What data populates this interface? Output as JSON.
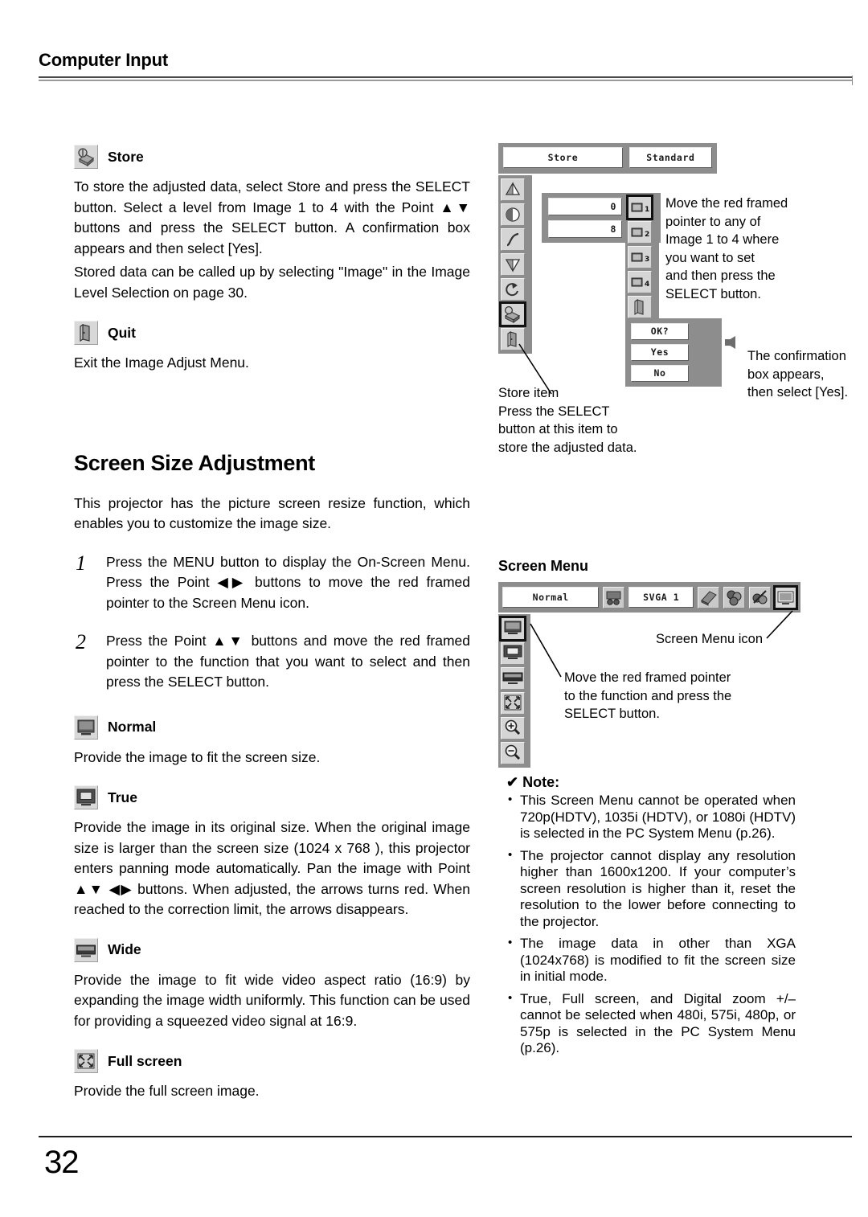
{
  "header": {
    "title": "Computer Input"
  },
  "left": {
    "store": {
      "icon": "store-hand-icon",
      "heading": "Store",
      "paragraph1": "To store the adjusted data, select Store and press the SELECT button.  Select a level from Image 1 to 4 with the Point ▲▼ buttons and press the SELECT button.  A confirmation box appears and then select [Yes].",
      "paragraph2": "Stored data can be called up by selecting \"Image\" in the Image Level Selection on page 30."
    },
    "quit": {
      "icon": "quit-door-icon",
      "heading": "Quit",
      "paragraph": "Exit the Image Adjust Menu."
    },
    "screen_size": {
      "title": "Screen Size Adjustment",
      "intro": "This projector has the picture screen resize function, which enables you to customize the image size.",
      "steps": [
        {
          "num": "1",
          "text": "Press the MENU button to display the On-Screen Menu.  Press the Point ◀▶ buttons to move the red framed pointer to the Screen Menu icon."
        },
        {
          "num": "2",
          "text": "Press the Point ▲▼ buttons and move the red framed pointer to the function that you want to select and then press the SELECT button."
        }
      ],
      "modes": [
        {
          "icon": "normal-screen-icon",
          "heading": "Normal",
          "text": "Provide the image to fit the screen size."
        },
        {
          "icon": "true-screen-icon",
          "heading": "True",
          "text": "Provide the image in its original size. When the original image size is larger than the screen size (1024 x 768 ), this projector enters panning mode automatically. Pan the image with Point ▲▼ ◀▶ buttons.  When adjusted, the arrows turns red.  When reached to the correction limit, the arrows disappears."
        },
        {
          "icon": "wide-screen-icon",
          "heading": "Wide",
          "text": "Provide the image to fit wide video aspect ratio (16:9) by expanding the image width uniformly.  This function can be used for providing a squeezed video signal at 16:9."
        },
        {
          "icon": "full-screen-icon",
          "heading": "Full screen",
          "text": "Provide the full screen image."
        }
      ]
    }
  },
  "image_adjust_osd": {
    "topbar": {
      "store_label": "Store",
      "standard_label": "Standard"
    },
    "menu_icons": [
      "contrast-up-icon",
      "contrast-icon",
      "gamma-curve-icon",
      "contrast-down-icon",
      "reset-icon",
      "store-hand-icon",
      "quit-door-icon"
    ],
    "selected_menu_icon": "store-hand-icon",
    "values": [
      "0",
      "8"
    ],
    "image_levels": [
      {
        "label": "1",
        "icon": "image-level-1-icon"
      },
      {
        "label": "2",
        "icon": "image-level-2-icon"
      },
      {
        "label": "3",
        "icon": "image-level-3-icon"
      },
      {
        "label": "4",
        "icon": "image-level-4-icon"
      },
      {
        "label": "",
        "icon": "quit-door-icon"
      }
    ],
    "selected_image_level": "1",
    "confirm": {
      "title": "OK?",
      "yes": "Yes",
      "no": "No"
    },
    "callouts": {
      "image_levels": "Move the red framed\npointer to any of\nImage 1 to 4 where\nyou want to set\nand then press the\nSELECT button.",
      "confirm": "The confirmation\nbox appears,\nthen select [Yes].",
      "store_item": "Store item\nPress the SELECT\nbutton at this item to\nstore the adjusted data."
    }
  },
  "screen_menu": {
    "title": "Screen Menu",
    "topbar": {
      "mode_label": "Normal",
      "system_label": "SVGA  1",
      "icons": [
        "input-source-icon",
        "pc-adjust-icon",
        "image-select-icon",
        "image-adjust-icon",
        "screen-menu-icon"
      ],
      "selected_icon": "screen-menu-icon"
    },
    "side_icons": [
      "normal-screen-icon",
      "true-screen-icon",
      "wide-screen-icon",
      "full-screen-icon",
      "digital-zoom-in-icon",
      "digital-zoom-out-icon"
    ],
    "selected_side_icon": "normal-screen-icon",
    "callouts": {
      "menu_icon": "Screen Menu icon",
      "pointer": "Move the red framed pointer\nto the function and press the\nSELECT button."
    }
  },
  "note": {
    "check_glyph": "✔",
    "heading": "Note:",
    "items": [
      "This Screen Menu cannot be operated when 720p(HDTV), 1035i (HDTV), or 1080i (HDTV) is selected in the PC System Menu (p.26).",
      "The projector cannot display any resolution higher than 1600x1200. If your computer’s screen resolution is higher than it, reset the resolution to the lower before connecting to the projector.",
      "The image data in other than XGA (1024x768) is modified to fit the screen size in initial mode.",
      "True, Full screen, and Digital zoom +/– cannot be selected when 480i, 575i, 480p, or 575p is selected in the PC System Menu (p.26)."
    ]
  },
  "footer": {
    "page_number": "32"
  }
}
